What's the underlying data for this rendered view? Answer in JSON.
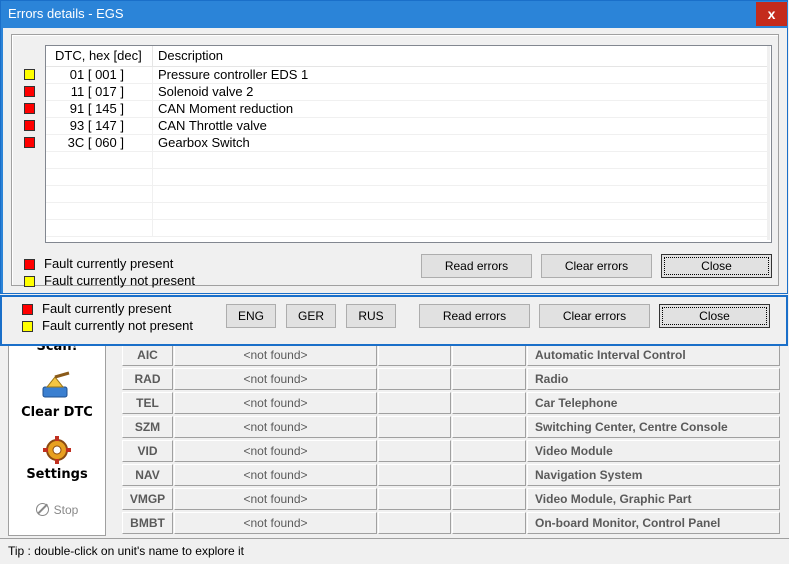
{
  "dialog": {
    "title": "Errors details - EGS",
    "close_glyph": "x",
    "table": {
      "columns": [
        "DTC, hex [dec]",
        "Description"
      ],
      "rows": [
        {
          "status": "yellow",
          "dtc": "01 [ 001 ]",
          "description": "Pressure controller EDS 1"
        },
        {
          "status": "red",
          "dtc": "11 [ 017 ]",
          "description": "Solenoid valve 2"
        },
        {
          "status": "red",
          "dtc": "91 [ 145 ]",
          "description": "CAN Moment reduction"
        },
        {
          "status": "red",
          "dtc": "93 [ 147 ]",
          "description": "CAN Throttle valve"
        },
        {
          "status": "red",
          "dtc": "3C [ 060 ]",
          "description": "Gearbox Switch"
        }
      ],
      "empty_rows": 5
    },
    "legend": {
      "present": "Fault currently present",
      "not_present": "Fault currently not present"
    },
    "buttons": {
      "read": "Read errors",
      "clear": "Clear errors",
      "close": "Close"
    }
  },
  "strip": {
    "legend": {
      "present": "Fault currently present",
      "not_present": "Fault currently not present"
    },
    "lang_buttons": [
      "ENG",
      "GER",
      "RUS"
    ],
    "buttons": {
      "read": "Read errors",
      "clear": "Clear errors",
      "close": "Close"
    }
  },
  "sidebar": {
    "scan": "Scan!",
    "clear_dtc": "Clear DTC",
    "settings": "Settings",
    "stop": "Stop"
  },
  "units": [
    {
      "code": "AIC",
      "version": "<not found>",
      "name": "Automatic Interval Control"
    },
    {
      "code": "RAD",
      "version": "<not found>",
      "name": "Radio"
    },
    {
      "code": "TEL",
      "version": "<not found>",
      "name": "Car Telephone"
    },
    {
      "code": "SZM",
      "version": "<not found>",
      "name": "Switching Center, Centre Console"
    },
    {
      "code": "VID",
      "version": "<not found>",
      "name": "Video Module"
    },
    {
      "code": "NAV",
      "version": "<not found>",
      "name": "Navigation System"
    },
    {
      "code": "VMGP",
      "version": "<not found>",
      "name": "Video Module, Graphic Part"
    },
    {
      "code": "BMBT",
      "version": "<not found>",
      "name": "On-board Monitor, Control Panel"
    }
  ],
  "status_bar": "Tip : double-click on unit's name to explore it",
  "colors": {
    "title_bar": "#2b84d8",
    "close_button": "#c42b1c",
    "fault_present": "#ff0000",
    "fault_not_present": "#ffff00"
  }
}
